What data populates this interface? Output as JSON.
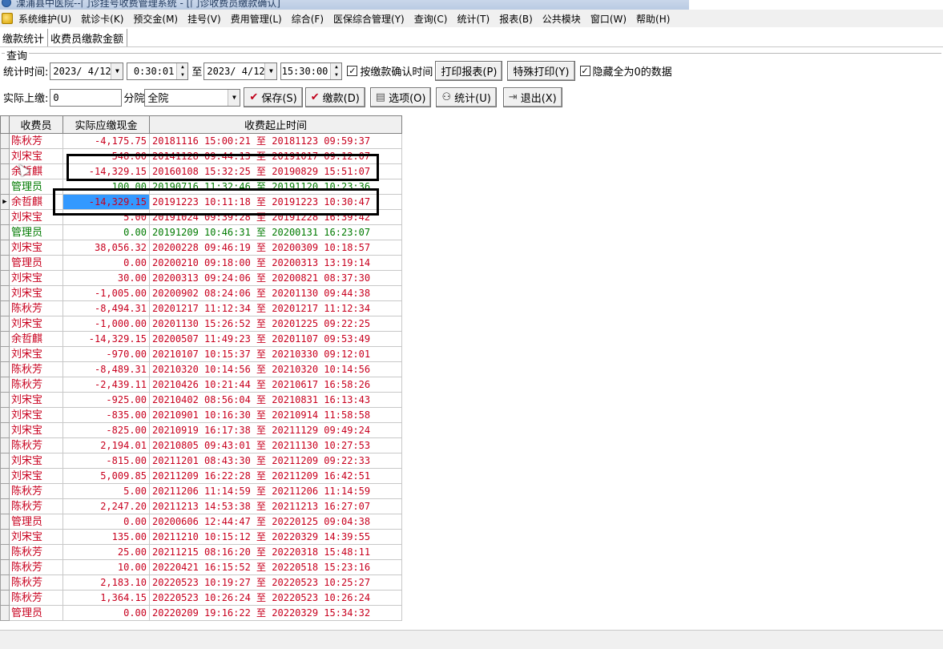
{
  "title": "溧浦县中医院--门诊挂号收费管理系统 - [门诊收费员缴款确认]",
  "menu": [
    "系统维护(U)",
    "就诊卡(K)",
    "预交金(M)",
    "挂号(V)",
    "费用管理(L)",
    "综合(F)",
    "医保综合管理(Y)",
    "查询(C)",
    "统计(T)",
    "报表(B)",
    "公共模块",
    "窗口(W)",
    "帮助(H)"
  ],
  "tabs": [
    "缴款统计",
    "收费员缴款金额"
  ],
  "query": {
    "caption": "查询",
    "time_label": "统计时间:",
    "start_date": "2023/ 4/12",
    "start_time": "0:30:01",
    "to_label": "至",
    "end_date": "2023/ 4/12",
    "end_time": "15:30:00",
    "confirm_time_label": "按缴款确认时间",
    "print_report": "打印报表(P)",
    "special_print": "特殊打印(Y)",
    "hide_zero_label": "隐藏全为0的数据",
    "actual_label": "实际上缴:",
    "actual_value": "0",
    "branch_label": "分院",
    "branch_value": "全院",
    "save": "保存(S)",
    "pay": "缴款(D)",
    "options": "选项(O)",
    "stats": "统计(U)",
    "exit": "退出(X)"
  },
  "grid": {
    "headers": [
      "收费员",
      "实际应缴现金",
      "收费起止时间"
    ],
    "rows": [
      {
        "who": "陈秋芳",
        "amt": "-4,175.75",
        "time": "20181116 15:00:21 至 20181123 09:59:37",
        "color": "red"
      },
      {
        "who": "刘宋宝",
        "amt": "548.00",
        "time": "20141128 09:44:13 至 20191017 09:12:07",
        "color": "red"
      },
      {
        "who": "余哲麒",
        "amt": "-14,329.15",
        "time": "20160108 15:32:25 至 20190829 15:51:07",
        "color": "red"
      },
      {
        "who": "管理员",
        "amt": "100.00",
        "time": "20190716 11:32:46 至 20191120 10:23:36",
        "color": "green"
      },
      {
        "who": "余哲麒",
        "amt": "-14,329.15",
        "time": "20191223 10:11:18 至 20191223 10:30:47",
        "color": "red",
        "selected": true
      },
      {
        "who": "刘宋宝",
        "amt": "5.00",
        "time": "20191024 09:39:28 至 20191228 16:39:42",
        "color": "red"
      },
      {
        "who": "管理员",
        "amt": "0.00",
        "time": "20191209 10:46:31 至 20200131 16:23:07",
        "color": "green"
      },
      {
        "who": "刘宋宝",
        "amt": "38,056.32",
        "time": "20200228 09:46:19 至 20200309 10:18:57",
        "color": "red"
      },
      {
        "who": "管理员",
        "amt": "0.00",
        "time": "20200210 09:18:00 至 20200313 13:19:14",
        "color": "red"
      },
      {
        "who": "刘宋宝",
        "amt": "30.00",
        "time": "20200313 09:24:06 至 20200821 08:37:30",
        "color": "red"
      },
      {
        "who": "刘宋宝",
        "amt": "-1,005.00",
        "time": "20200902 08:24:06 至 20201130 09:44:38",
        "color": "red"
      },
      {
        "who": "陈秋芳",
        "amt": "-8,494.31",
        "time": "20201217 11:12:34 至 20201217 11:12:34",
        "color": "red"
      },
      {
        "who": "刘宋宝",
        "amt": "-1,000.00",
        "time": "20201130 15:26:52 至 20201225 09:22:25",
        "color": "red"
      },
      {
        "who": "余哲麒",
        "amt": "-14,329.15",
        "time": "20200507 11:49:23 至 20201107 09:53:49",
        "color": "red"
      },
      {
        "who": "刘宋宝",
        "amt": "-970.00",
        "time": "20210107 10:15:37 至 20210330 09:12:01",
        "color": "red"
      },
      {
        "who": "陈秋芳",
        "amt": "-8,489.31",
        "time": "20210320 10:14:56 至 20210320 10:14:56",
        "color": "red"
      },
      {
        "who": "陈秋芳",
        "amt": "-2,439.11",
        "time": "20210426 10:21:44 至 20210617 16:58:26",
        "color": "red"
      },
      {
        "who": "刘宋宝",
        "amt": "-925.00",
        "time": "20210402 08:56:04 至 20210831 16:13:43",
        "color": "red"
      },
      {
        "who": "刘宋宝",
        "amt": "-835.00",
        "time": "20210901 10:16:30 至 20210914 11:58:58",
        "color": "red"
      },
      {
        "who": "刘宋宝",
        "amt": "-825.00",
        "time": "20210919 16:17:38 至 20211129 09:49:24",
        "color": "red"
      },
      {
        "who": "陈秋芳",
        "amt": "2,194.01",
        "time": "20210805 09:43:01 至 20211130 10:27:53",
        "color": "red"
      },
      {
        "who": "刘宋宝",
        "amt": "-815.00",
        "time": "20211201 08:43:30 至 20211209 09:22:33",
        "color": "red"
      },
      {
        "who": "刘宋宝",
        "amt": "5,009.85",
        "time": "20211209 16:22:28 至 20211209 16:42:51",
        "color": "red"
      },
      {
        "who": "陈秋芳",
        "amt": "5.00",
        "time": "20211206 11:14:59 至 20211206 11:14:59",
        "color": "red"
      },
      {
        "who": "陈秋芳",
        "amt": "2,247.20",
        "time": "20211213 14:53:38 至 20211213 16:27:07",
        "color": "red"
      },
      {
        "who": "管理员",
        "amt": "0.00",
        "time": "20200606 12:44:47 至 20220125 09:04:38",
        "color": "red"
      },
      {
        "who": "刘宋宝",
        "amt": "135.00",
        "time": "20211210 10:15:12 至 20220329 14:39:55",
        "color": "red"
      },
      {
        "who": "陈秋芳",
        "amt": "25.00",
        "time": "20211215 08:16:20 至 20220318 15:48:11",
        "color": "red"
      },
      {
        "who": "陈秋芳",
        "amt": "10.00",
        "time": "20220421 16:15:52 至 20220518 15:23:16",
        "color": "red"
      },
      {
        "who": "陈秋芳",
        "amt": "2,183.10",
        "time": "20220523 10:19:27 至 20220523 10:25:27",
        "color": "red"
      },
      {
        "who": "陈秋芳",
        "amt": "1,364.15",
        "time": "20220523 10:26:24 至 20220523 10:26:24",
        "color": "red"
      },
      {
        "who": "管理员",
        "amt": "0.00",
        "time": "20220209 19:16:22 至 20220329 15:34:32",
        "color": "red"
      }
    ]
  },
  "colors": {
    "red": "#c8001e",
    "green": "#007a00",
    "selection": "#3399ff"
  }
}
